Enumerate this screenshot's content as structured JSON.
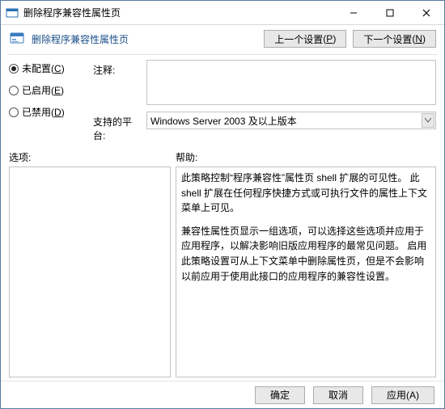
{
  "window": {
    "title": "删除程序兼容性属性页"
  },
  "header": {
    "title": "删除程序兼容性属性页",
    "prev_label": "上一个设置",
    "prev_accel": "P",
    "next_label": "下一个设置",
    "next_accel": "N"
  },
  "radios": {
    "not_configured": {
      "label": "未配置",
      "accel": "C"
    },
    "enabled": {
      "label": "已启用",
      "accel": "E"
    },
    "disabled": {
      "label": "已禁用",
      "accel": "D"
    },
    "selected": "not_configured"
  },
  "fields": {
    "comment_label": "注释:",
    "comment_value": "",
    "platform_label": "支持的平台:",
    "platform_value": "Windows Server 2003 及以上版本"
  },
  "sections": {
    "options_label": "选项:",
    "help_label": "帮助:"
  },
  "help": {
    "p1": "此策略控制“程序兼容性”属性页 shell 扩展的可见性。 此 shell 扩展在任何程序快捷方式或可执行文件的属性上下文菜单上可见。",
    "p2": "兼容性属性页显示一组选项，可以选择这些选项并应用于应用程序，以解决影响旧版应用程序的最常见问题。   启用此策略设置可从上下文菜单中删除属性页，但是不会影响以前应用于使用此接口的应用程序的兼容性设置。"
  },
  "footer": {
    "ok": "确定",
    "cancel": "取消",
    "apply": "应用(A)"
  }
}
